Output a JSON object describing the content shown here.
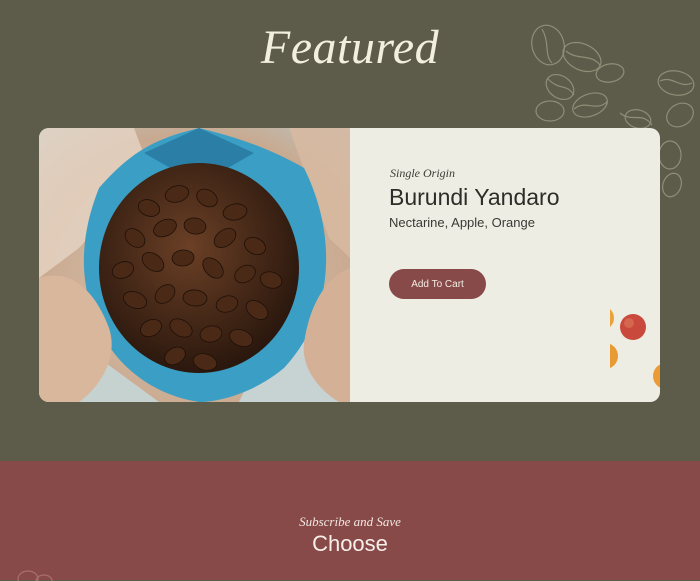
{
  "header": {
    "title": "Featured"
  },
  "product": {
    "eyebrow": "Single Origin",
    "name": "Burundi Yandaro",
    "notes": "Nectarine, Apple, Orange",
    "button_label": "Add To Cart"
  },
  "subscribe": {
    "eyebrow": "Subscribe and Save",
    "heading": "Choose"
  },
  "colors": {
    "background": "#5d5c4a",
    "card": "#eeede4",
    "accent": "#874a48",
    "bag_blue": "#3b9ec4"
  },
  "icons": {
    "doodles": "coffee-bean-doodle-icon",
    "fruits": "fruit-illustration-icon"
  }
}
